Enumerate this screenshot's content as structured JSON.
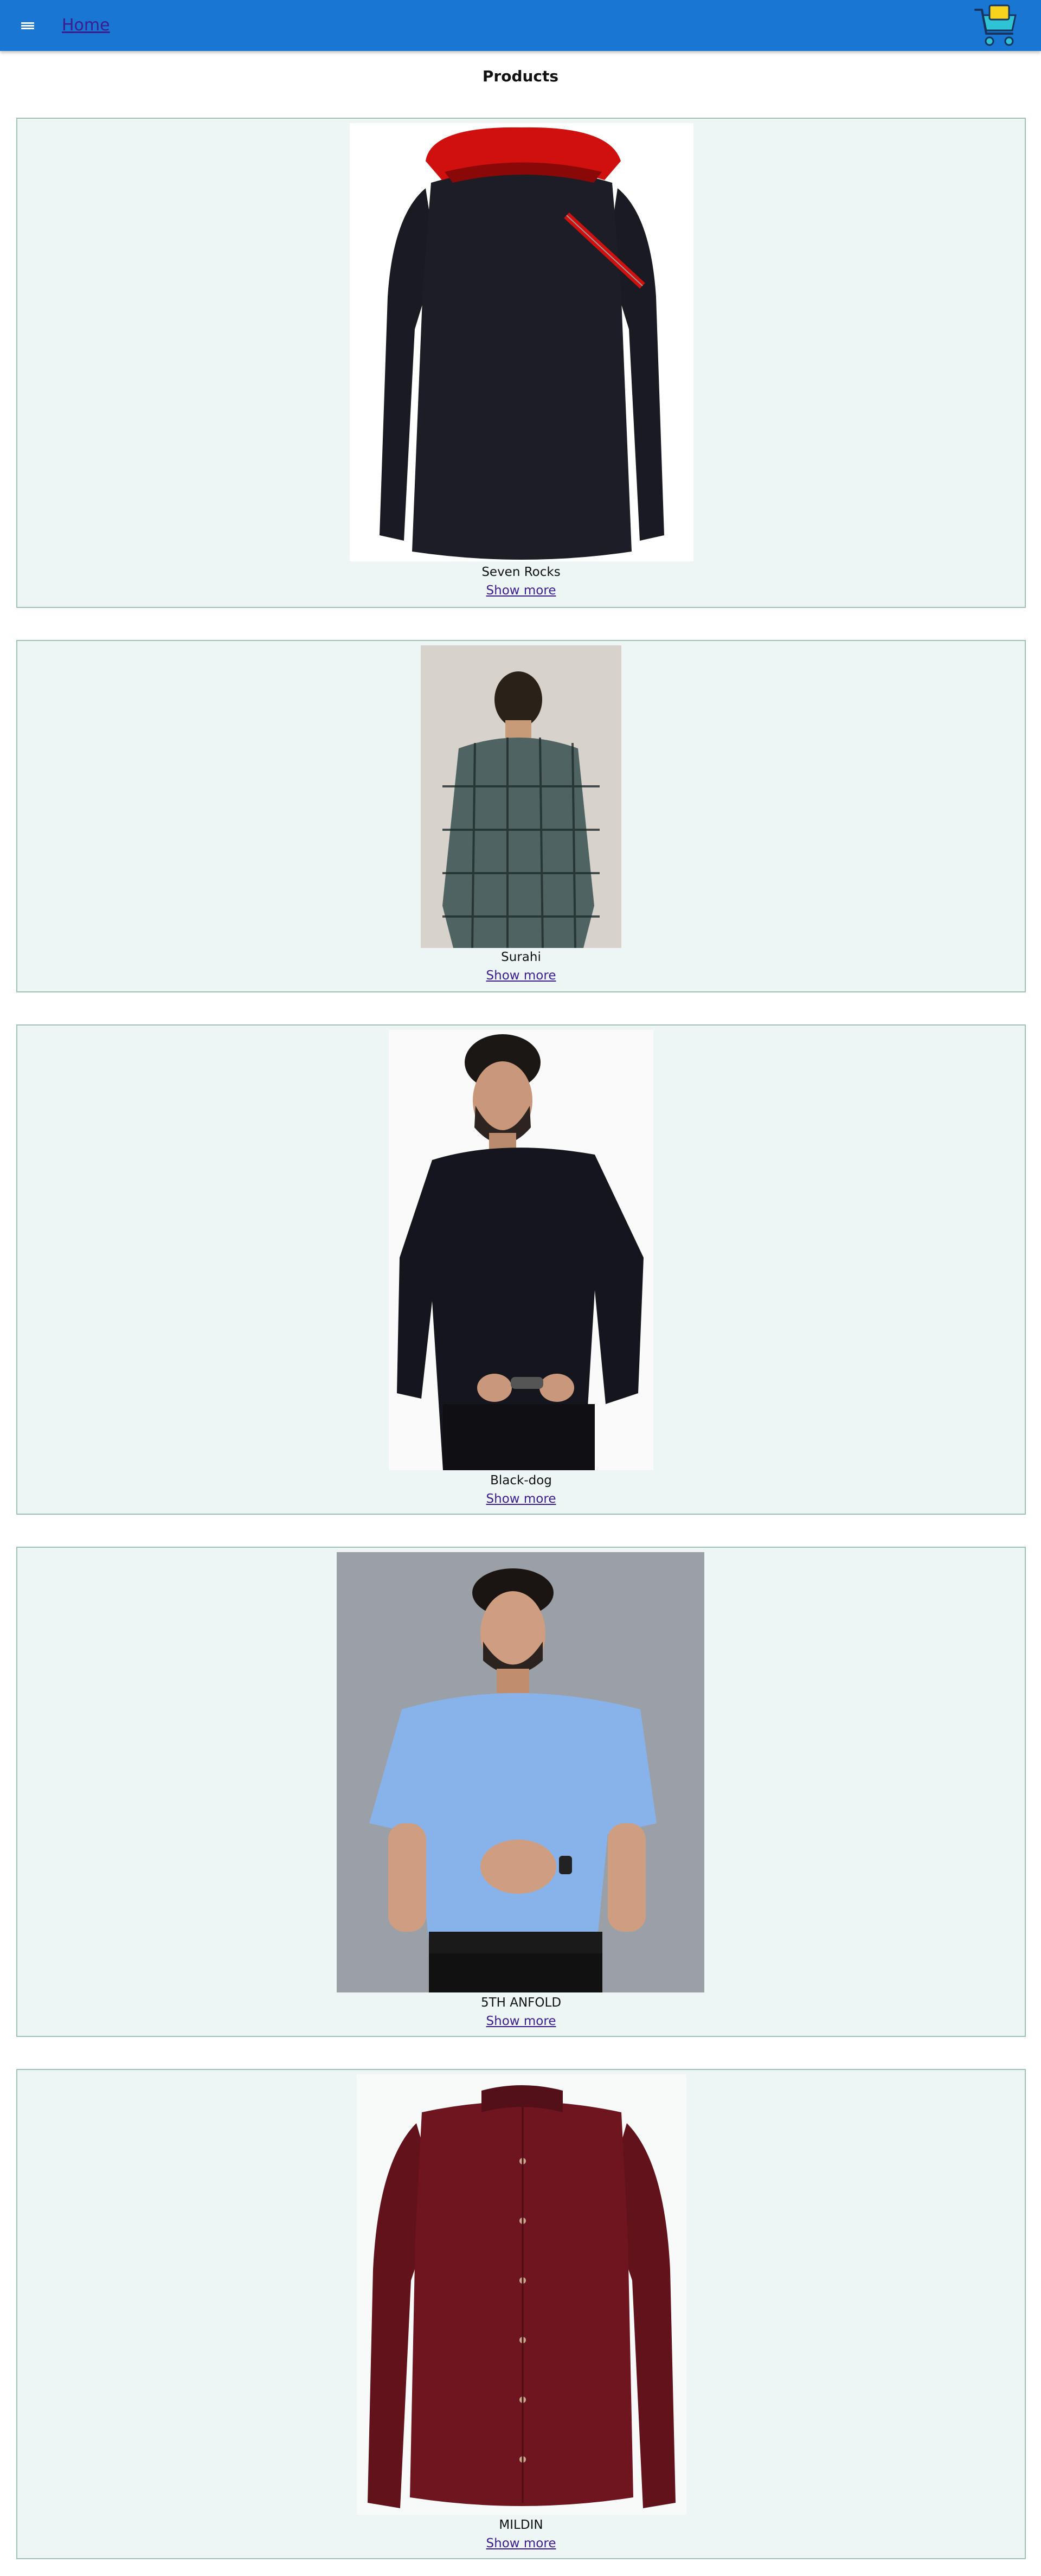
{
  "header": {
    "menu_icon": "hamburger-menu-icon",
    "home_label": "Home",
    "cart_icon": "shopping-cart-icon",
    "background_color": "#1976d2"
  },
  "page": {
    "title": "Products"
  },
  "products": [
    {
      "name": "Seven Rocks",
      "more_label": "Show more",
      "image": "black hoodie with red hood lining"
    },
    {
      "name": "Surahi",
      "more_label": "Show more",
      "image": "man in grey-green checked shirt, back view"
    },
    {
      "name": "Black-dog",
      "more_label": "Show more",
      "image": "man in black shirt"
    },
    {
      "name": "5TH ANFOLD",
      "more_label": "Show more",
      "image": "man in light blue short-sleeve shirt"
    },
    {
      "name": "MILDIN",
      "more_label": "Show more",
      "image": "maroon mandarin-collar shirt"
    }
  ],
  "colors": {
    "card_background": "#edf5f5",
    "card_border": "#9fc2b6",
    "link": "#3b1d8f"
  }
}
